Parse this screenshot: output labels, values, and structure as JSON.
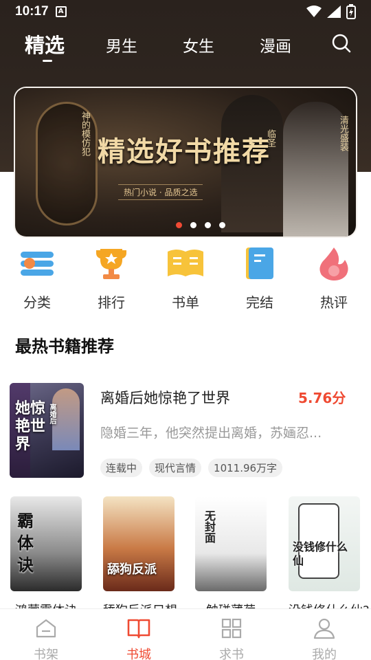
{
  "status": {
    "time": "10:17",
    "a_badge": "A"
  },
  "top_nav": {
    "tabs": [
      "精选",
      "男生",
      "女生",
      "漫画"
    ],
    "active_index": 0
  },
  "banner": {
    "title": "精选好书推荐",
    "subtitle": "热门小说 · 品质之选",
    "vtext_left": "神的模仿犯",
    "vtext_mid": "临圣",
    "vtext_right": "清光盛装",
    "dots": 4,
    "active_dot": 0
  },
  "categories": [
    {
      "label": "分类",
      "icon": "list-icon"
    },
    {
      "label": "排行",
      "icon": "trophy-icon"
    },
    {
      "label": "书单",
      "icon": "open-book-icon"
    },
    {
      "label": "完结",
      "icon": "notebook-icon"
    },
    {
      "label": "热评",
      "icon": "flame-icon"
    }
  ],
  "section_title": "最热书籍推荐",
  "featured": {
    "title": "离婚后她惊艳了世界",
    "score": "5.76分",
    "description": "隐婚三年，他突然提出离婚，苏婳忍...",
    "tags": [
      "连载中",
      "现代言情",
      "1011.96万字"
    ],
    "cover_text": "她惊艳世界",
    "cover_small": "离婚后"
  },
  "books": [
    {
      "title": "鸿蒙霸体诀",
      "cover_text": "霸体诀"
    },
    {
      "title": "舔狗反派只想",
      "cover_text": "舔狗反派"
    },
    {
      "title": "触碰薄荷",
      "cover_text": "无封面"
    },
    {
      "title": "没钱修什么仙?",
      "cover_text": "没钱修什么仙"
    }
  ],
  "bottom_nav": [
    {
      "label": "书架",
      "icon": "bookshelf-icon"
    },
    {
      "label": "书城",
      "icon": "book-icon"
    },
    {
      "label": "求书",
      "icon": "grid-icon"
    },
    {
      "label": "我的",
      "icon": "user-icon"
    }
  ],
  "colors": {
    "accent": "#ef4a32",
    "hero_bg": "#2f2620"
  }
}
